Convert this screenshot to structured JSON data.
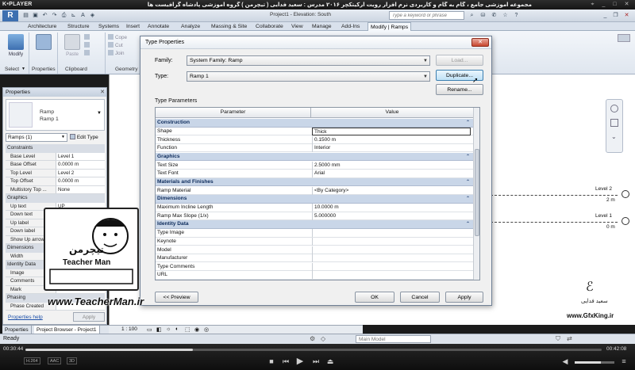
{
  "player": {
    "logo": "K•PLAYER",
    "title": "مجموعه آموزشی جامع ، گام به گام و کاربردی نرم افزار رویت آرکیتکچر ۲۰۱۶   مدرس : سعید فدایی ( تیچرمن ) گروه آموزشی پادشاه گرافیست ها",
    "time_current": "00:30:44",
    "time_total": "00:42:08",
    "progress_fraction": 0.29,
    "volume_fraction": 0.66,
    "tags": [
      "H.264",
      "AAC",
      "3D"
    ]
  },
  "revit": {
    "doc_title": "Project1 - Elevation: South",
    "search_placeholder": "Type a keyword or phrase",
    "tabs": [
      "Architecture",
      "Structure",
      "Systems",
      "Insert",
      "Annotate",
      "Analyze",
      "Massing & Site",
      "Collaborate",
      "View",
      "Manage",
      "Add-Ins",
      "Modify | Ramps"
    ],
    "ribbon": {
      "modify_label": "Modify",
      "paste_label": "Paste",
      "cope_label": "Cope",
      "cut_label": "Cut",
      "join_label": "Join",
      "panels": [
        "Select",
        "Properties",
        "Clipboard",
        "Geometry"
      ]
    },
    "status": "Ready",
    "active_workset": "Main Model",
    "scale": "1 : 100"
  },
  "properties": {
    "title": "Properties",
    "type_family": "Ramp",
    "type_name": "Ramp 1",
    "instance_selector": "Ramps (1)",
    "edit_type": "Edit Type",
    "groups": [
      {
        "name": "Constraints",
        "rows": [
          {
            "k": "Base Level",
            "v": "Level 1"
          },
          {
            "k": "Base Offset",
            "v": "0.0000 m"
          },
          {
            "k": "Top Level",
            "v": "Level 2"
          },
          {
            "k": "Top Offset",
            "v": "0.0000 m"
          },
          {
            "k": "Multistory Top ...",
            "v": "None"
          }
        ]
      },
      {
        "name": "Graphics",
        "rows": [
          {
            "k": "Up text",
            "v": "UP"
          },
          {
            "k": "Down text",
            "v": "DN"
          },
          {
            "k": "Up label",
            "v": ""
          },
          {
            "k": "Down label",
            "v": ""
          },
          {
            "k": "Show Up arrow",
            "v": ""
          }
        ]
      },
      {
        "name": "Dimensions",
        "rows": [
          {
            "k": "Width",
            "v": ""
          }
        ]
      },
      {
        "name": "Identity Data",
        "rows": [
          {
            "k": "Image",
            "v": ""
          },
          {
            "k": "Comments",
            "v": ""
          },
          {
            "k": "Mark",
            "v": ""
          }
        ]
      },
      {
        "name": "Phasing",
        "rows": [
          {
            "k": "Phase Created",
            "v": ""
          }
        ]
      }
    ],
    "help": "Properties help",
    "apply": "Apply",
    "dock_tabs": [
      "Properties",
      "Project Browser - Project1"
    ]
  },
  "canvas": {
    "levels": [
      {
        "name": "Level 2",
        "elev": "2 m"
      },
      {
        "name": "Level 1",
        "elev": "0 m"
      }
    ]
  },
  "dialog": {
    "title": "Type Properties",
    "family_label": "Family:",
    "family_value": "System Family: Ramp",
    "type_label": "Type:",
    "type_value": "Ramp 1",
    "load": "Load...",
    "duplicate": "Duplicate...",
    "rename": "Rename...",
    "type_params_label": "Type Parameters",
    "col_param": "Parameter",
    "col_value": "Value",
    "groups": [
      {
        "name": "Construction",
        "rows": [
          {
            "p": "Shape",
            "v": "Thick"
          },
          {
            "p": "Thickness",
            "v": "0.1500 m"
          },
          {
            "p": "Function",
            "v": "Interior"
          }
        ]
      },
      {
        "name": "Graphics",
        "rows": [
          {
            "p": "Text Size",
            "v": "2.5000 mm"
          },
          {
            "p": "Text Font",
            "v": "Arial"
          }
        ]
      },
      {
        "name": "Materials and Finishes",
        "rows": [
          {
            "p": "Ramp Material",
            "v": "<By Category>"
          }
        ]
      },
      {
        "name": "Dimensions",
        "rows": [
          {
            "p": "Maximum Incline Length",
            "v": "10.0000 m"
          },
          {
            "p": "Ramp Max Slope (1/x)",
            "v": "5.000000"
          }
        ]
      },
      {
        "name": "Identity Data",
        "rows": [
          {
            "p": "Type Image",
            "v": ""
          },
          {
            "p": "Keynote",
            "v": ""
          },
          {
            "p": "Model",
            "v": ""
          },
          {
            "p": "Manufacturer",
            "v": ""
          },
          {
            "p": "Type Comments",
            "v": ""
          },
          {
            "p": "URL",
            "v": ""
          }
        ]
      }
    ],
    "preview": "<< Preview",
    "ok": "OK",
    "cancel": "Cancel",
    "apply": "Apply"
  },
  "watermark": {
    "site": "www.TeacherMan.ir",
    "brand_fa": "تیچرمن",
    "brand_en": "Teacher Man",
    "gfx_name": "سعید فدایی",
    "gfx_site": "www.GfxKing.ir"
  }
}
